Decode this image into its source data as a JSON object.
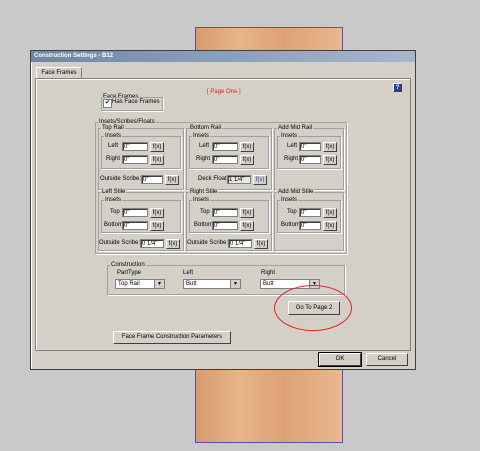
{
  "dialog": {
    "title": "Construction Settings - B12",
    "help_glyph": "?",
    "tab_label": "Face Frames",
    "page_heading": "[ Page One ]",
    "face_frames": {
      "group_label": "Face Frames",
      "has_face_frames_label": "Has Face Frames",
      "checked_glyph": "✔"
    },
    "insets_group_label": "Insets/Scribes/Floats",
    "top_rail": {
      "label": "Top Rail",
      "insets": "Insets",
      "left_label": "Left",
      "left_value": "0\"",
      "right_label": "Right",
      "right_value": "0\"",
      "outside_scribe_label": "Outside Scribe:",
      "outside_scribe_value": "0\""
    },
    "bottom_rail": {
      "label": "Bottom Rail",
      "insets": "Insets",
      "left_label": "Left",
      "left_value": "0\"",
      "right_label": "Right",
      "right_value": "0\"",
      "deck_float_label": "Deck Float:",
      "deck_float_value": "1 1/4\""
    },
    "add_mid_rail": {
      "label": "Add Mid Rail",
      "insets": "Insets",
      "left_label": "Left",
      "left_value": "0\"",
      "right_label": "Right",
      "right_value": "0\""
    },
    "left_stile": {
      "label": "Left Stile",
      "insets": "Insets",
      "top_label": "Top",
      "top_value": "0\"",
      "bottom_label": "Bottom",
      "bottom_value": "0\"",
      "outside_scribe_label": "Outside Scribe:",
      "outside_scribe_value": "0 1/4\""
    },
    "right_stile": {
      "label": "Right Stile",
      "insets": "Insets",
      "top_label": "Top",
      "top_value": "0\"",
      "bottom_label": "Bottom",
      "bottom_value": "0\"",
      "outside_scribe_label": "Outside Scribe:",
      "outside_scribe_value": "0 1/4\""
    },
    "add_mid_stile": {
      "label": "Add Mid Stile",
      "insets": "Insets",
      "top_label": "Top",
      "top_value": "0\"",
      "bottom_label": "Bottom",
      "bottom_value": "0\""
    },
    "fx_label": "f(x)",
    "construction": {
      "group_label": "Construction",
      "parttype_label": "PartType",
      "parttype_value": "Top Rail",
      "left_label": "Left",
      "left_value": "Butt",
      "right_label": "Right",
      "right_value": "Butt"
    },
    "go_to_page2": "Go To Page 2",
    "parameters_button": "Face Frame Construction Parameters",
    "ok_button": "OK",
    "cancel_button": "Cancel",
    "dropdown_arrow": "▼"
  },
  "colors": {
    "accent_red": "#e02020",
    "titlebar": "#6e87a8",
    "wood": "#e0a878"
  }
}
